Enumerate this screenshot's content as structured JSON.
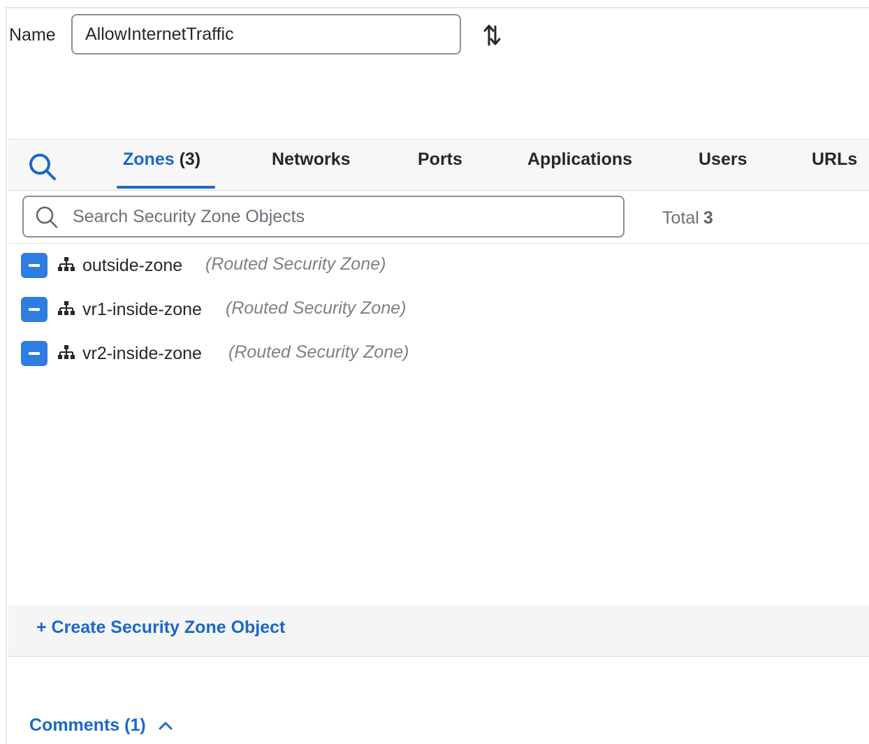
{
  "name_field": {
    "label": "Name",
    "value": "AllowInternetTraffic"
  },
  "tabs": [
    {
      "label": "Zones",
      "count": "(3)",
      "active": true
    },
    {
      "label": "Networks"
    },
    {
      "label": "Ports"
    },
    {
      "label": "Applications"
    },
    {
      "label": "Users"
    },
    {
      "label": "URLs"
    }
  ],
  "search": {
    "placeholder": "Search Security Zone Objects",
    "total_label": "Total",
    "total_value": "3"
  },
  "zones": [
    {
      "name": "outside-zone",
      "type": "(Routed Security Zone)"
    },
    {
      "name": "vr1-inside-zone",
      "type": "(Routed Security Zone)"
    },
    {
      "name": "vr2-inside-zone",
      "type": "(Routed Security Zone)"
    }
  ],
  "create_label": "+ Create Security Zone Object",
  "comments_label": "Comments (1)",
  "colors": {
    "accent": "#1b68c9",
    "remove_button": "#2f7de1",
    "muted": "#7d8187"
  },
  "icons": [
    "swap-arrows-icon",
    "search-icon",
    "minus-icon",
    "zone-hierarchy-icon",
    "chevron-up-icon"
  ]
}
